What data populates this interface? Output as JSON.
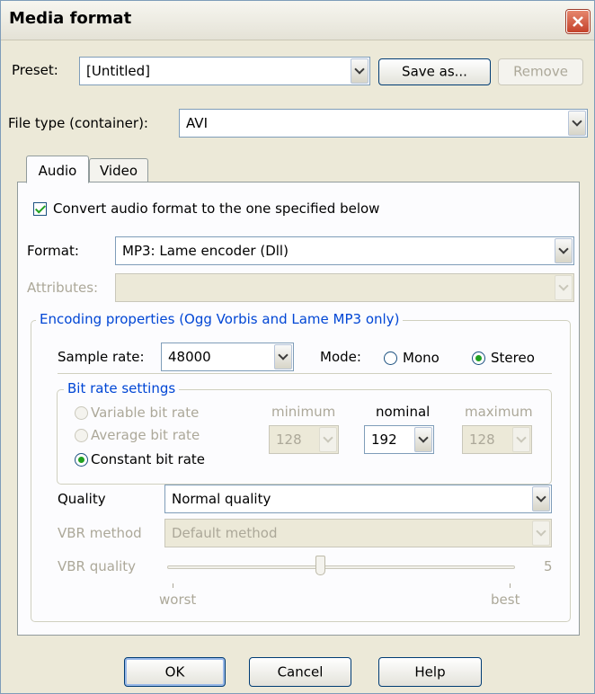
{
  "window": {
    "title": "Media format"
  },
  "preset": {
    "label": "Preset:",
    "value": "[Untitled]",
    "save_as": "Save as...",
    "remove": "Remove"
  },
  "file_type": {
    "label": "File type (container):",
    "value": "AVI"
  },
  "tabs": [
    {
      "label": "Audio",
      "active": true
    },
    {
      "label": "Video",
      "active": false
    }
  ],
  "audio": {
    "convert_label": "Convert audio format to the one specified below",
    "convert_checked": true,
    "format_label": "Format:",
    "format_value": "MP3: Lame encoder (Dll)",
    "attributes_label": "Attributes:",
    "attributes_value": "",
    "encoding": {
      "group_title": "Encoding properties (Ogg Vorbis and Lame MP3 only)",
      "sample_rate_label": "Sample rate:",
      "sample_rate_value": "48000",
      "mode_label": "Mode:",
      "mode_options": [
        "Mono",
        "Stereo"
      ],
      "mode_selected": "Stereo",
      "bitrate": {
        "group_title": "Bit rate settings",
        "options": [
          "Variable bit rate",
          "Average bit rate",
          "Constant bit rate"
        ],
        "selected": "Constant bit rate",
        "minimum_label": "minimum",
        "nominal_label": "nominal",
        "maximum_label": "maximum",
        "minimum_value": "128",
        "nominal_value": "192",
        "maximum_value": "128"
      },
      "quality_label": "Quality",
      "quality_value": "Normal quality",
      "vbr_method_label": "VBR method",
      "vbr_method_value": "Default method",
      "vbr_quality_label": "VBR quality",
      "vbr_quality_value": "5",
      "vbr_quality_level": 0.44,
      "worst_label": "worst",
      "best_label": "best"
    }
  },
  "buttons": {
    "ok": "OK",
    "cancel": "Cancel",
    "help": "Help"
  }
}
